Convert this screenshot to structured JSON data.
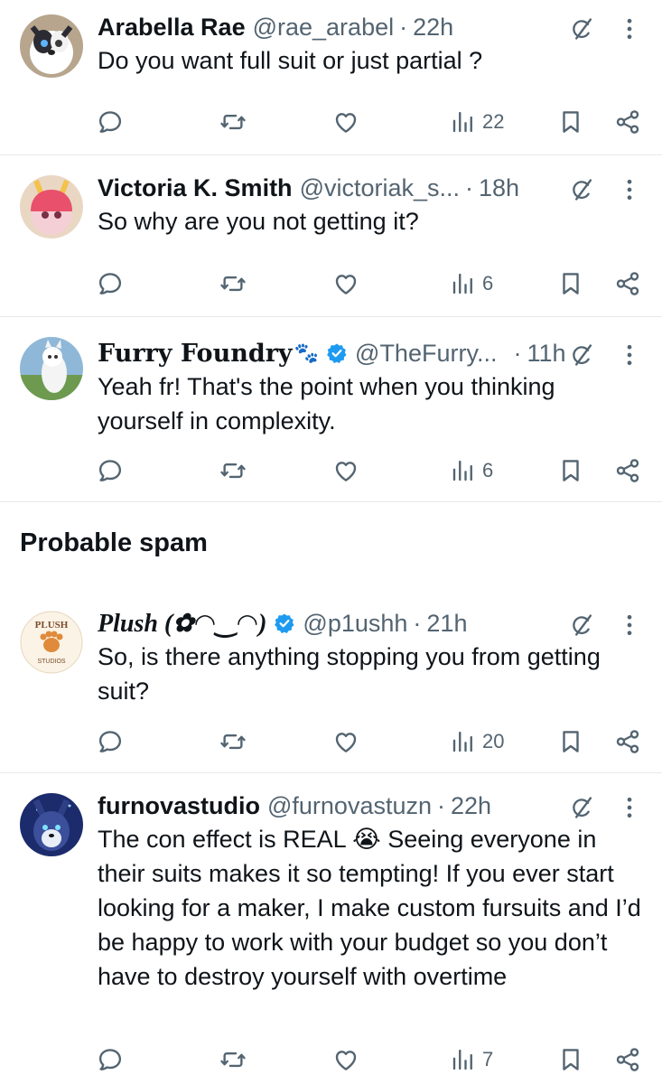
{
  "tweets": [
    {
      "display_name": "Arabella Rae",
      "handle": "@rae_arabel",
      "separator": "·",
      "time": "22h",
      "verified": false,
      "text": "Do you want full suit or just partial ?",
      "views": "22"
    },
    {
      "display_name": "Victoria K. Smith",
      "handle": "@victoriak_s...",
      "separator": "·",
      "time": "18h",
      "verified": false,
      "text": "So why are you not getting it?",
      "views": "6"
    },
    {
      "display_name": "Furry Foundry",
      "name_emoji": "🐾",
      "handle": "@TheFurry...",
      "separator": "·",
      "time": "11h",
      "verified": true,
      "text": "Yeah fr! That's the point when you thinking yourself in complexity.",
      "views": "6"
    },
    {
      "display_name": "Plush (✿◠‿◠)",
      "handle": "@p1ushh",
      "separator": "·",
      "time": "21h",
      "verified": true,
      "text": "So, is there anything stopping you from getting suit?",
      "views": "20"
    },
    {
      "display_name": "furnovastudio",
      "handle": "@furnovastuzn",
      "separator": "·",
      "time": "22h",
      "verified": false,
      "text": "The con effect is REAL 😭 Seeing everyone in their suits makes it so tempting! If you ever start looking for a maker, I make custom fursuits and I’d be happy to work with your budget so you don’t have to destroy yourself with overtime",
      "views": "7"
    }
  ],
  "sections": {
    "probable_spam": "Probable spam"
  },
  "avatar_logo_text": {
    "plush_top": "PLUSH",
    "plush_bottom": "STUDIOS"
  },
  "colors": {
    "text_primary": "#0f1419",
    "text_secondary": "#536471",
    "verified_blue": "#1d9bf0",
    "divider": "#e6e9eb"
  },
  "icons": {
    "reply": "reply-icon",
    "repost": "repost-icon",
    "like": "like-icon",
    "views": "views-icon",
    "bookmark": "bookmark-icon",
    "share": "share-icon",
    "grok": "grok-icon",
    "more": "more-icon"
  }
}
